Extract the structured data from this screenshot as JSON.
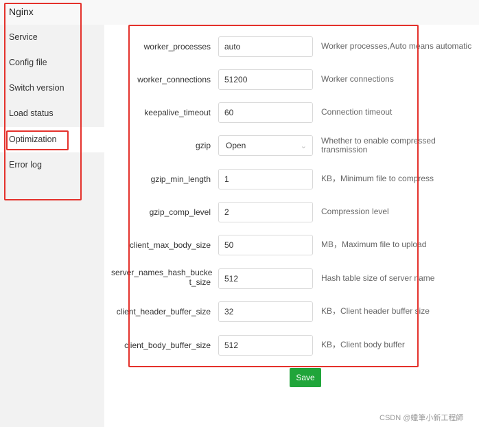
{
  "app": {
    "title": "Nginx"
  },
  "sidebar": {
    "items": [
      {
        "label": "Service"
      },
      {
        "label": "Config file"
      },
      {
        "label": "Switch version"
      },
      {
        "label": "Load status"
      },
      {
        "label": "Optimization",
        "active": true
      },
      {
        "label": "Error log"
      }
    ]
  },
  "form": {
    "rows": [
      {
        "label": "worker_processes",
        "value": "auto",
        "help": "Worker processes,Auto means automatic"
      },
      {
        "label": "worker_connections",
        "value": "51200",
        "help": "Worker connections"
      },
      {
        "label": "keepalive_timeout",
        "value": "60",
        "help": "Connection timeout"
      },
      {
        "label": "gzip",
        "value": "Open",
        "help": "Whether to enable compressed transmission"
      },
      {
        "label": "gzip_min_length",
        "value": "1",
        "help": "KB，Minimum file to compress"
      },
      {
        "label": "gzip_comp_level",
        "value": "2",
        "help": "Compression level"
      },
      {
        "label": "client_max_body_size",
        "value": "50",
        "help": "MB，Maximum file to upload"
      },
      {
        "label": "server_names_hash_bucket_size",
        "label_line1": "server_names_hash_bucke",
        "label_line2": "t_size",
        "value": "512",
        "help": "Hash table size of server name"
      },
      {
        "label": "client_header_buffer_size",
        "value": "32",
        "help": "KB，Client header buffer size"
      },
      {
        "label": "client_body_buffer_size",
        "value": "512",
        "help": "KB，Client body buffer"
      }
    ],
    "save_label": "Save"
  },
  "watermark": "CSDN @蠟筆小新工程師",
  "colors": {
    "highlight_border": "#e4312b",
    "save_button": "#20a53a",
    "sidebar_bg": "#f2f2f2"
  },
  "icons": {
    "select_arrow": "chevron-down-icon"
  }
}
